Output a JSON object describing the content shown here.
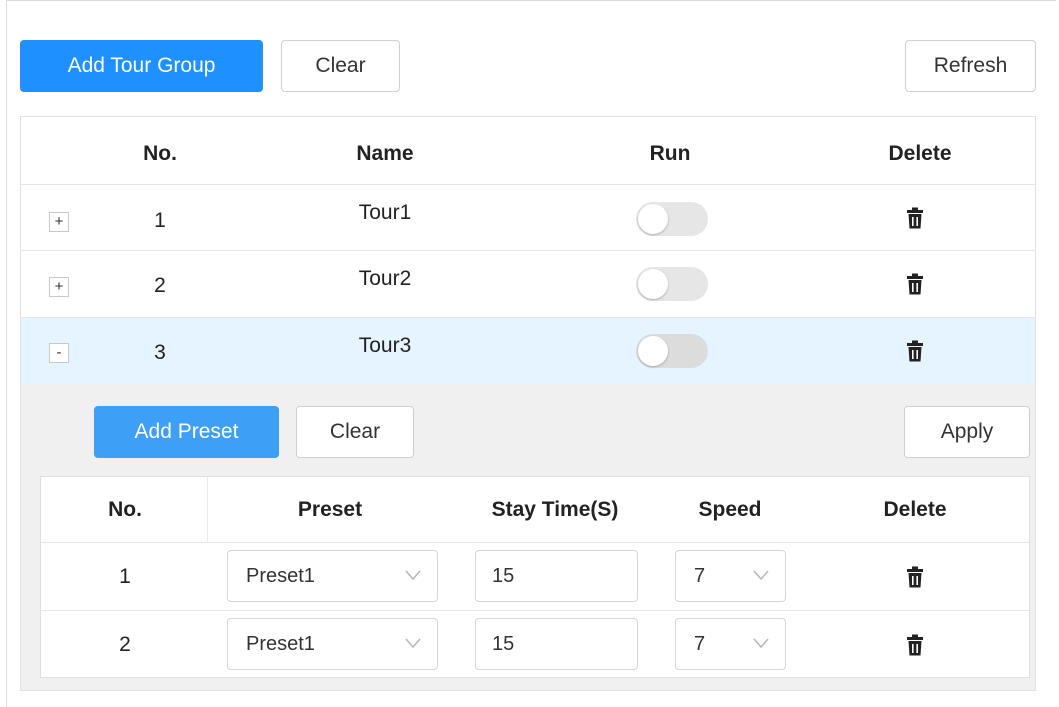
{
  "toolbar": {
    "add_tour_group": "Add Tour Group",
    "clear": "Clear",
    "refresh": "Refresh"
  },
  "tour_table": {
    "headers": {
      "no": "No.",
      "name": "Name",
      "run": "Run",
      "delete": "Delete"
    },
    "rows": [
      {
        "expander": "+",
        "no": "1",
        "name": "Tour1",
        "run": false
      },
      {
        "expander": "+",
        "no": "2",
        "name": "Tour2",
        "run": false
      },
      {
        "expander": "-",
        "no": "3",
        "name": "Tour3",
        "run": false
      }
    ]
  },
  "preset_panel": {
    "add_preset": "Add Preset",
    "clear": "Clear",
    "apply": "Apply",
    "headers": {
      "no": "No.",
      "preset": "Preset",
      "stay_time": "Stay Time(S)",
      "speed": "Speed",
      "delete": "Delete"
    },
    "rows": [
      {
        "no": "1",
        "preset": "Preset1",
        "stay_time": "15",
        "speed": "7"
      },
      {
        "no": "2",
        "preset": "Preset1",
        "stay_time": "15",
        "speed": "7"
      }
    ]
  },
  "colors": {
    "primary": "#1e90ff",
    "selected_row": "#e6f4ff",
    "panel_bg": "#f0f0f0"
  },
  "icons": {
    "delete": "trash-icon",
    "dropdown": "chevron-down-icon"
  }
}
